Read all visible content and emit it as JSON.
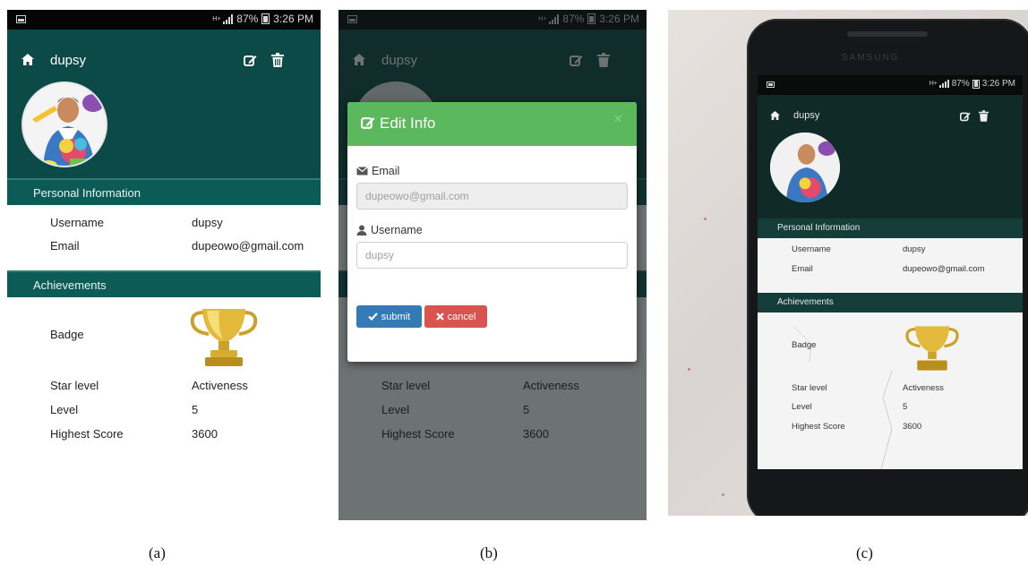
{
  "status_bar": {
    "network": "H+",
    "battery": "87%",
    "time": "3:26 PM"
  },
  "app_bar": {
    "title": "dupsy",
    "icons": [
      "home-icon",
      "edit-icon",
      "trash-icon"
    ]
  },
  "personal_info": {
    "heading": "Personal Information",
    "rows": [
      {
        "key": "Username",
        "value": "dupsy"
      },
      {
        "key": "Email",
        "value": "dupeowo@gmail.com"
      }
    ]
  },
  "achievements": {
    "heading": "Achievements",
    "badge_label": "Badge",
    "badge_icon": "trophy-icon",
    "rows": [
      {
        "key": "Star level",
        "value": "Activeness"
      },
      {
        "key": "Level",
        "value": "5"
      },
      {
        "key": "Highest Score",
        "value": "3600"
      }
    ]
  },
  "edit_modal": {
    "title": "Edit Info",
    "close": "×",
    "email_label": "Email",
    "email_value": "dupeowo@gmail.com",
    "username_label": "Username",
    "username_value": "dupsy",
    "submit_label": "submit",
    "cancel_label": "cancel"
  },
  "phone_brand": "SAMSUNG",
  "captions": [
    "(a)",
    "(b)",
    "(c)"
  ],
  "colors": {
    "header": "#0b4a46",
    "section_bar": "#0c5b56",
    "modal_header": "#5cb85c",
    "submit": "#337ab7",
    "cancel": "#d9534f"
  }
}
